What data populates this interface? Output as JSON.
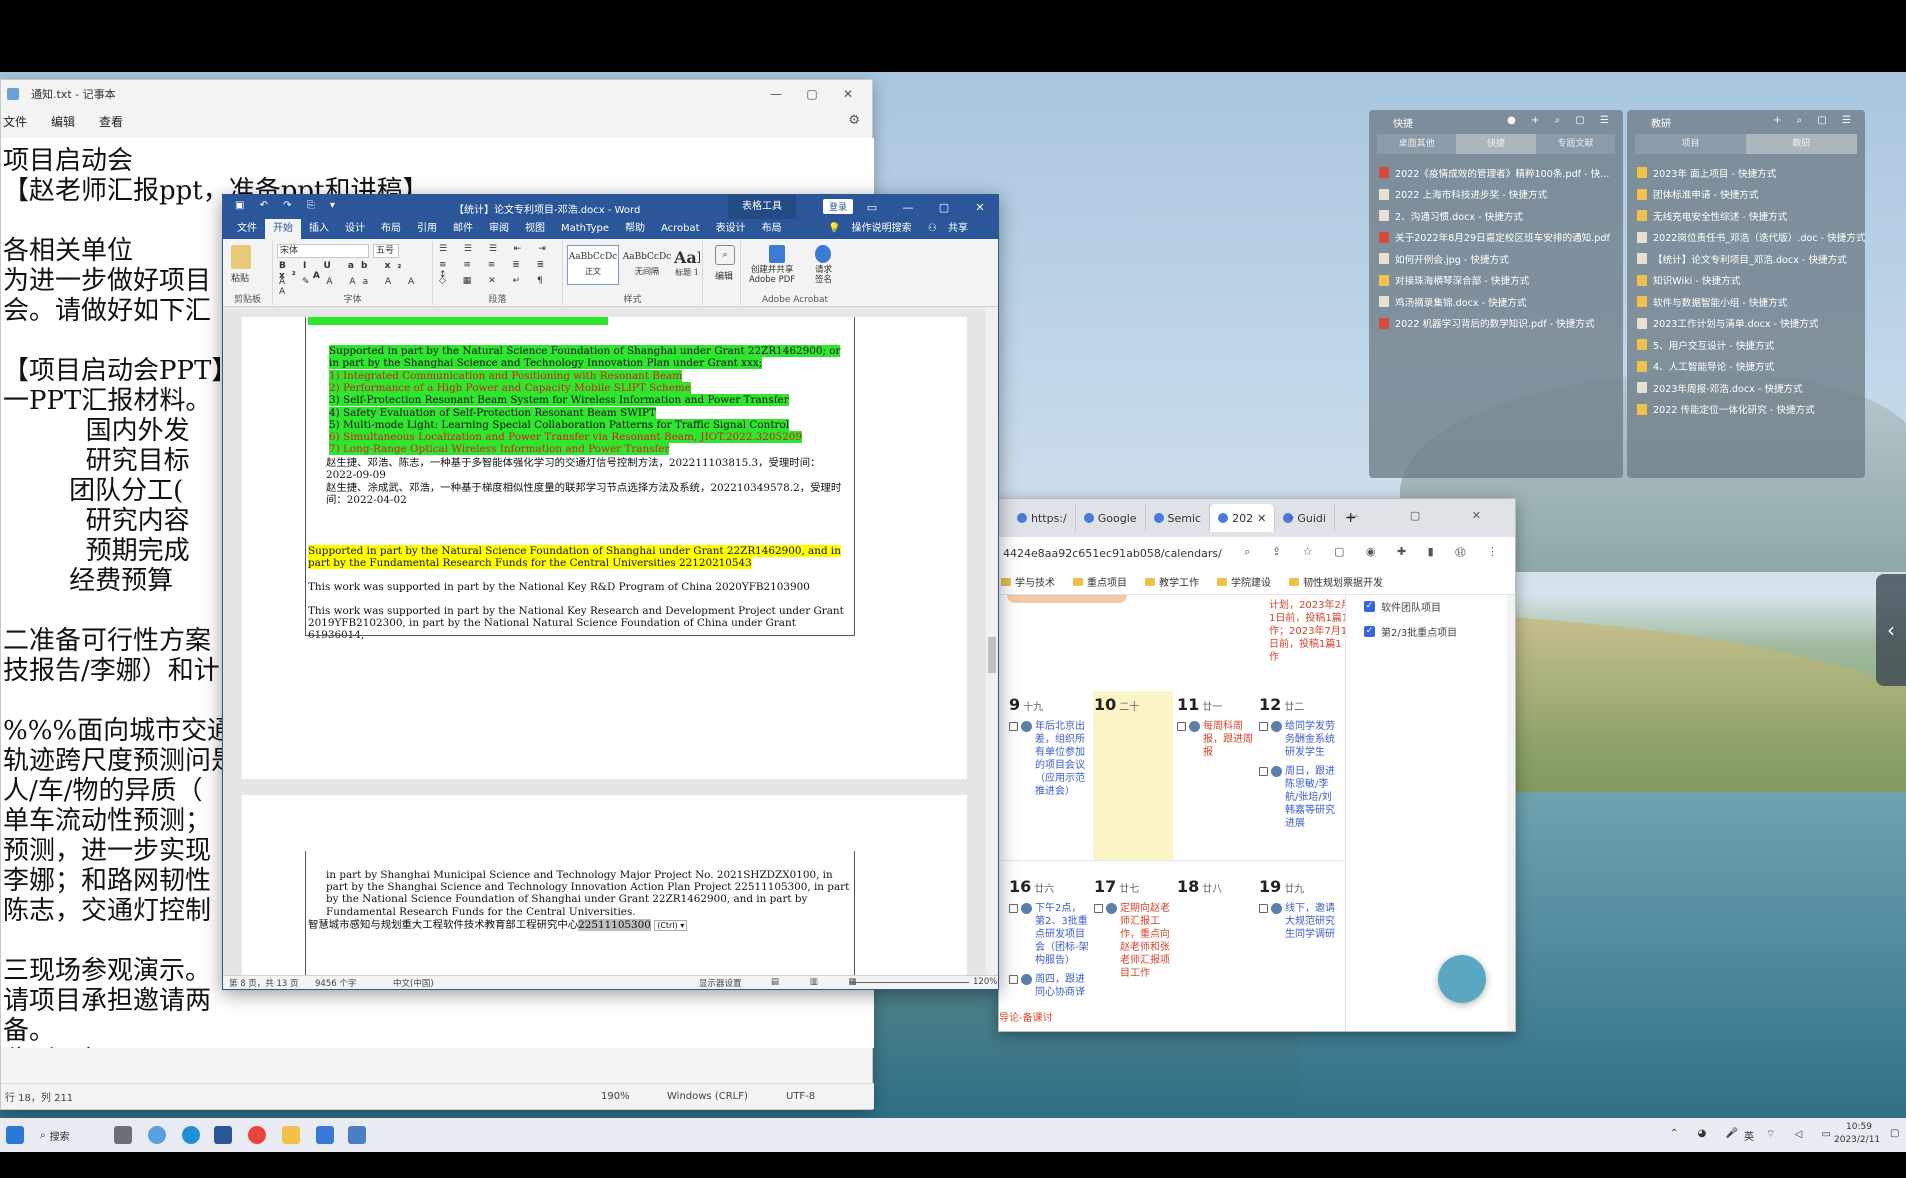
{
  "notepad": {
    "title": "通知.txt - 记事本",
    "menu": [
      "文件",
      "编辑",
      "查看"
    ],
    "text": "项目启动会\n【赵老师汇报ppt，准备ppt和讲稿】\n\n各相关单位\n为进一步做好项目\n会。请做好如下汇\n\n【项目启动会PPT】\n一PPT汇报材料。\n          国内外发\n          研究目标\n        团队分工(\n          研究内容\n          预期完成\n        经费预算\n\n二准备可行性方案\n技报告/李娜）和计\n\n%%%面向城市交通态\n轨迹跨尺度预测问是\n人/车/物的异质（\n单车流动性预测；\n预测，进一步实现\n李娜；和路网韧性\n陈志，交通灯控制\n\n三现场参观演示。\n请项目承担邀请两\n备。\n收到回复\n\n【启动会的输出成果\n场照片，专家签到表，支付专家咨询费】",
    "status": {
      "pos": "行 18，列 211",
      "zoom": "190%",
      "eol": "Windows (CRLF)",
      "enc": "UTF-8"
    }
  },
  "word": {
    "quick_access": "▣ ↶ ↷ ⎘ ▾",
    "title": "【统计】论文专利项目-邓浩.docx - Word",
    "context_tab": "表格工具",
    "login": "登录",
    "tabs": [
      "文件",
      "开始",
      "插入",
      "设计",
      "布局",
      "引用",
      "邮件",
      "审阅",
      "视图",
      "MathType",
      "帮助",
      "Acrobat",
      "表设计",
      "布局"
    ],
    "tell_me": "操作说明搜索",
    "share": "共享",
    "font_name": "宋体",
    "font_size": "五号",
    "groups": [
      "剪贴板",
      "字体",
      "段落",
      "样式",
      "编辑",
      "Adobe Acrobat"
    ],
    "styles": [
      "AaBbCcDc",
      "AaBbCcDc",
      "AaBl"
    ],
    "style_names": [
      "正文",
      "无间隔",
      "标题 1"
    ],
    "paste": "粘贴",
    "edit": "编辑",
    "acrobat_create": "创建并共享\nAdobe PDF",
    "acrobat_sign": "请求\n签名",
    "p1": "Supported in part by the Natural Science Foundation of Shanghai under Grant 22ZR1462900;   or in part by the Shanghai Science and Technology Innovation Plan under Grant xxx;",
    "list": [
      "1) Integrated Communication and Positioning with Resonant Beam",
      "2) Performance of a High Power and Capacity Mobile SLIPT Scheme",
      "3) Self-Protection Resonant Beam System for Wireless Information and Power Transfer",
      "4) Safety Evaluation of Self-Protection Resonant Beam SWIPT",
      "5) Multi-mode Light: Learning Special Collaboration Patterns for Traffic Signal Control",
      "6) Simultaneous Localization and Power Transfer via Resonant Beam, JIOT.2022.3205209",
      "7)  Long-Range Optical Wireless Information and Power Transfer"
    ],
    "patent1": "赵生捷、邓浩、陈志，一种基于多智能体强化学习的交通灯信号控制方法，202211103815.3，受理时间：2022-09-09",
    "patent2": "赵生捷、涂成武、邓浩，一种基于梯度相似性度量的联邦学习节点选择方法及系统，202210349578.2，受理时间：2022-04-02",
    "p_yellow": "Supported in part by the Natural Science Foundation of Shanghai under Grant 22ZR1462900, and in part by the Fundamental Research Funds for the Central Universities 22120210543",
    "p_key": "This work was supported in part by the National Key R&D Program of China 2020YFB2103900",
    "p_key2": "This work was supported in part by the National Key Research and Development Project under Grant 2019YFB2102300, in part by the National Natural Science Foundation of China under Grant 61936014,",
    "p_page2": "in part by Shanghai Municipal Science and Technology Major Project No. 2021SHZDZX0100, in part by the Shanghai Science and Technology Innovation Action Plan Project 22511105300, in part by the National Science Foundation of Shanghai under Grant 22ZR1462900, and in part by Fundamental Research Funds for the Central Universities.",
    "p_center": "智慧城市感知与规划重大工程软件技术教育部工程研究中心",
    "p_center_num": "22511105300",
    "ctrl_tag": "(Ctrl) ▾",
    "status": {
      "page": "第 8 页，共 13 页",
      "words": "9456 个字",
      "lang": "中文(中国)",
      "display": "显示器设置",
      "zoom": "120%"
    }
  },
  "browser": {
    "tabs": [
      "https:/",
      "Google",
      "Semic",
      "202",
      "Guidi"
    ],
    "url": "4424e8aa92c651ec91ab058/calendars/",
    "bookmarks": [
      "学与技术",
      "重点项目",
      "教学工作",
      "学院建设",
      "韧性规划票据开发"
    ],
    "calendars": [
      "软件团队项目",
      "第2/3批重点项目"
    ],
    "top_event": "计划，2023年2月1日前，投稿1篇1作；2023年7月1日前，投稿1篇1作",
    "days": [
      {
        "d": "9",
        "l": "十九",
        "ev": [
          {
            "t": "年后北京出差，组织所有单位参加的项目会议（应用示范推进会）",
            "c": "blue"
          }
        ]
      },
      {
        "d": "10",
        "l": "二十",
        "ev": []
      },
      {
        "d": "11",
        "l": "廿一",
        "ev": [
          {
            "t": "每周科周报，跟进周报",
            "c": "red"
          }
        ]
      },
      {
        "d": "12",
        "l": "廿二",
        "ev": [
          {
            "t": "给同学发劳务酬金系统研发学生",
            "c": "blue"
          },
          {
            "t": "周日，跟进陈思敏/李航/张培/刘韩嘉等研究进展",
            "c": "blue"
          }
        ]
      },
      {
        "d": "16",
        "l": "廿六",
        "ev": [
          {
            "t": "下午2点，第2、3批重点研发项目会（团标-架构服告）",
            "c": "blue"
          },
          {
            "t": "周四，跟进同心协商译",
            "c": "blue"
          }
        ]
      },
      {
        "d": "17",
        "l": "廿七",
        "ev": [
          {
            "t": "定期向赵老师汇报工作，重点向赵老师和张老师汇报项目工作",
            "c": "red"
          }
        ]
      },
      {
        "d": "18",
        "l": "廿八",
        "ev": []
      },
      {
        "d": "19",
        "l": "廿九",
        "ev": [
          {
            "t": "线下，邀请大规范研究生同学调研",
            "c": "blue"
          }
        ]
      }
    ],
    "bottom_note": "导论-备课讨"
  },
  "fence_left": {
    "title": "快捷",
    "tabs": [
      "桌面其他",
      "快捷",
      "专题文献"
    ],
    "items": [
      {
        "t": "2022《疫情成效的管理者》精粹100条.pdf - 快...",
        "k": "pdf"
      },
      {
        "t": "2022 上海市科技进步奖 - 快捷方式",
        "k": "doc"
      },
      {
        "t": "2、沟通习惯.docx - 快捷方式",
        "k": "doc"
      },
      {
        "t": "关于2022年8月29日嘉定校区班车安排的通知.pdf",
        "k": "pdf"
      },
      {
        "t": "如何开例会.jpg - 快捷方式",
        "k": "doc"
      },
      {
        "t": "对接珠海横琴深合部 - 快捷方式",
        "k": "fold"
      },
      {
        "t": "鸡汤摘录集锦.docx - 快捷方式",
        "k": "doc"
      },
      {
        "t": "2022 机器学习背后的数学知识.pdf - 快捷方式",
        "k": "pdf"
      }
    ]
  },
  "fence_right": {
    "title": "教研",
    "tabs": [
      "项目",
      "教研"
    ],
    "items": [
      {
        "t": "2023年 面上项目 - 快捷方式",
        "k": "fold"
      },
      {
        "t": "团体标准申请 - 快捷方式",
        "k": "fold"
      },
      {
        "t": "无线充电安全性综述 - 快捷方式",
        "k": "fold"
      },
      {
        "t": "2022岗位责任书_邓浩（迭代版）.doc - 快捷方式",
        "k": "doc"
      },
      {
        "t": "【统计】论文专利项目_邓浩.docx - 快捷方式",
        "k": "doc"
      },
      {
        "t": "知识Wiki - 快捷方式",
        "k": "fold"
      },
      {
        "t": "软件与数据智能小组 - 快捷方式",
        "k": "fold"
      },
      {
        "t": "2023工作计划与清单.docx - 快捷方式",
        "k": "doc"
      },
      {
        "t": "5、用户交互设计 - 快捷方式",
        "k": "fold"
      },
      {
        "t": "4、人工智能导论 - 快捷方式",
        "k": "fold"
      },
      {
        "t": "2023年周报-邓浩.docx - 快捷方式",
        "k": "doc"
      },
      {
        "t": "2022 传能定位一体化研究 - 快捷方式",
        "k": "fold"
      }
    ]
  },
  "taskbar": {
    "search": "搜索",
    "ime": "英",
    "time": "10:59",
    "date": "2023/2/11"
  }
}
